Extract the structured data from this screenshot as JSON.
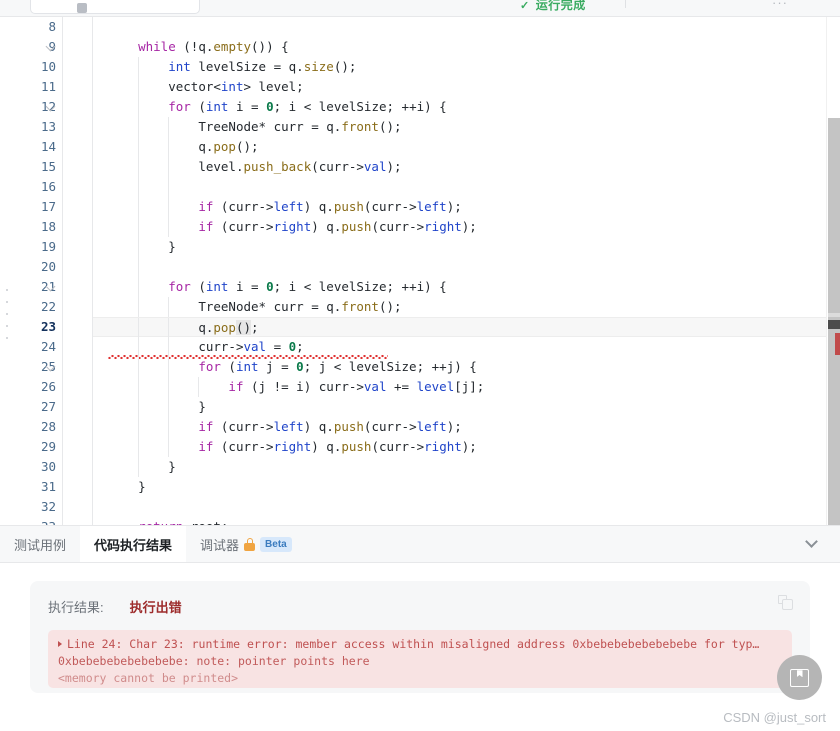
{
  "topbar": {
    "center_status": "运行完成",
    "check_glyph": "✓",
    "more_glyph": "···"
  },
  "editor": {
    "first_line_number": 8,
    "active_line_number": 23,
    "error_squiggle_line": 24,
    "lines": [
      {
        "n": 8,
        "indent": 0,
        "tokens": []
      },
      {
        "n": 9,
        "indent": 1,
        "fold": true,
        "tokens": [
          {
            "t": "while",
            "c": "kw"
          },
          {
            "t": " (!",
            "c": "pl"
          },
          {
            "t": "q",
            "c": "pl"
          },
          {
            "t": ".",
            "c": "pl"
          },
          {
            "t": "empty",
            "c": "fn"
          },
          {
            "t": "()) {",
            "c": "pl"
          }
        ]
      },
      {
        "n": 10,
        "indent": 2,
        "tokens": [
          {
            "t": "int",
            "c": "typ"
          },
          {
            "t": " levelSize = ",
            "c": "pl"
          },
          {
            "t": "q",
            "c": "pl"
          },
          {
            "t": ".",
            "c": "pl"
          },
          {
            "t": "size",
            "c": "fn"
          },
          {
            "t": "();",
            "c": "pl"
          }
        ]
      },
      {
        "n": 11,
        "indent": 2,
        "tokens": [
          {
            "t": "vector<",
            "c": "pl"
          },
          {
            "t": "int",
            "c": "typ"
          },
          {
            "t": "> level;",
            "c": "pl"
          }
        ]
      },
      {
        "n": 12,
        "indent": 2,
        "fold": true,
        "tokens": [
          {
            "t": "for",
            "c": "kw"
          },
          {
            "t": " (",
            "c": "pl"
          },
          {
            "t": "int",
            "c": "typ"
          },
          {
            "t": " i = ",
            "c": "pl"
          },
          {
            "t": "0",
            "c": "num"
          },
          {
            "t": "; i < levelSize; ++i) {",
            "c": "pl"
          }
        ]
      },
      {
        "n": 13,
        "indent": 3,
        "tokens": [
          {
            "t": "TreeNode* curr = ",
            "c": "pl"
          },
          {
            "t": "q",
            "c": "pl"
          },
          {
            "t": ".",
            "c": "pl"
          },
          {
            "t": "front",
            "c": "fn"
          },
          {
            "t": "();",
            "c": "pl"
          }
        ]
      },
      {
        "n": 14,
        "indent": 3,
        "tokens": [
          {
            "t": "q",
            "c": "pl"
          },
          {
            "t": ".",
            "c": "pl"
          },
          {
            "t": "pop",
            "c": "fn"
          },
          {
            "t": "();",
            "c": "pl"
          }
        ]
      },
      {
        "n": 15,
        "indent": 3,
        "tokens": [
          {
            "t": "level",
            "c": "pl"
          },
          {
            "t": ".",
            "c": "pl"
          },
          {
            "t": "push_back",
            "c": "fn"
          },
          {
            "t": "(curr->",
            "c": "pl"
          },
          {
            "t": "val",
            "c": "mem"
          },
          {
            "t": ");",
            "c": "pl"
          }
        ]
      },
      {
        "n": 16,
        "indent": 3,
        "tokens": []
      },
      {
        "n": 17,
        "indent": 3,
        "tokens": [
          {
            "t": "if",
            "c": "kw"
          },
          {
            "t": " (curr->",
            "c": "pl"
          },
          {
            "t": "left",
            "c": "mem"
          },
          {
            "t": ") q",
            "c": "pl"
          },
          {
            "t": ".",
            "c": "pl"
          },
          {
            "t": "push",
            "c": "fn"
          },
          {
            "t": "(curr->",
            "c": "pl"
          },
          {
            "t": "left",
            "c": "mem"
          },
          {
            "t": ");",
            "c": "pl"
          }
        ]
      },
      {
        "n": 18,
        "indent": 3,
        "tokens": [
          {
            "t": "if",
            "c": "kw"
          },
          {
            "t": " (curr->",
            "c": "pl"
          },
          {
            "t": "right",
            "c": "mem"
          },
          {
            "t": ") q",
            "c": "pl"
          },
          {
            "t": ".",
            "c": "pl"
          },
          {
            "t": "push",
            "c": "fn"
          },
          {
            "t": "(curr->",
            "c": "pl"
          },
          {
            "t": "right",
            "c": "mem"
          },
          {
            "t": ");",
            "c": "pl"
          }
        ]
      },
      {
        "n": 19,
        "indent": 2,
        "tokens": [
          {
            "t": "}",
            "c": "pl"
          }
        ]
      },
      {
        "n": 20,
        "indent": 2,
        "tokens": []
      },
      {
        "n": 21,
        "indent": 2,
        "fold": true,
        "tokens": [
          {
            "t": "for",
            "c": "kw"
          },
          {
            "t": " (",
            "c": "pl"
          },
          {
            "t": "int",
            "c": "typ"
          },
          {
            "t": " i = ",
            "c": "pl"
          },
          {
            "t": "0",
            "c": "num"
          },
          {
            "t": "; i < levelSize; ++i) {",
            "c": "pl"
          }
        ]
      },
      {
        "n": 22,
        "indent": 3,
        "tokens": [
          {
            "t": "TreeNode* curr = ",
            "c": "pl"
          },
          {
            "t": "q",
            "c": "pl"
          },
          {
            "t": ".",
            "c": "pl"
          },
          {
            "t": "front",
            "c": "fn"
          },
          {
            "t": "();",
            "c": "pl"
          }
        ]
      },
      {
        "n": 23,
        "indent": 3,
        "active": true,
        "tokens": [
          {
            "t": "q",
            "c": "pl"
          },
          {
            "t": ".",
            "c": "pl"
          },
          {
            "t": "pop",
            "c": "fn"
          },
          {
            "t": "(",
            "c": "brkt"
          },
          {
            "t": ")",
            "c": "brkt"
          },
          {
            "t": ";",
            "c": "pl"
          }
        ]
      },
      {
        "n": 24,
        "indent": 3,
        "squiggle": true,
        "tokens": [
          {
            "t": "curr->",
            "c": "pl"
          },
          {
            "t": "val",
            "c": "mem"
          },
          {
            "t": " = ",
            "c": "pl"
          },
          {
            "t": "0",
            "c": "num"
          },
          {
            "t": ";",
            "c": "pl"
          }
        ]
      },
      {
        "n": 25,
        "indent": 3,
        "fold": true,
        "tokens": [
          {
            "t": "for",
            "c": "kw"
          },
          {
            "t": " (",
            "c": "pl"
          },
          {
            "t": "int",
            "c": "typ"
          },
          {
            "t": " j = ",
            "c": "pl"
          },
          {
            "t": "0",
            "c": "num"
          },
          {
            "t": "; j < levelSize; ++j) {",
            "c": "pl"
          }
        ]
      },
      {
        "n": 26,
        "indent": 4,
        "tokens": [
          {
            "t": "if",
            "c": "kw"
          },
          {
            "t": " (j != i) curr->",
            "c": "pl"
          },
          {
            "t": "val",
            "c": "mem"
          },
          {
            "t": " += ",
            "c": "pl"
          },
          {
            "t": "level",
            "c": "mem"
          },
          {
            "t": "[j];",
            "c": "pl"
          }
        ]
      },
      {
        "n": 27,
        "indent": 3,
        "tokens": [
          {
            "t": "}",
            "c": "pl"
          }
        ]
      },
      {
        "n": 28,
        "indent": 3,
        "tokens": [
          {
            "t": "if",
            "c": "kw"
          },
          {
            "t": " (curr->",
            "c": "pl"
          },
          {
            "t": "left",
            "c": "mem"
          },
          {
            "t": ") q",
            "c": "pl"
          },
          {
            "t": ".",
            "c": "pl"
          },
          {
            "t": "push",
            "c": "fn"
          },
          {
            "t": "(curr->",
            "c": "pl"
          },
          {
            "t": "left",
            "c": "mem"
          },
          {
            "t": ");",
            "c": "pl"
          }
        ]
      },
      {
        "n": 29,
        "indent": 3,
        "tokens": [
          {
            "t": "if",
            "c": "kw"
          },
          {
            "t": " (curr->",
            "c": "pl"
          },
          {
            "t": "right",
            "c": "mem"
          },
          {
            "t": ") q",
            "c": "pl"
          },
          {
            "t": ".",
            "c": "pl"
          },
          {
            "t": "push",
            "c": "fn"
          },
          {
            "t": "(curr->",
            "c": "pl"
          },
          {
            "t": "right",
            "c": "mem"
          },
          {
            "t": ");",
            "c": "pl"
          }
        ]
      },
      {
        "n": 30,
        "indent": 2,
        "tokens": [
          {
            "t": "}",
            "c": "pl"
          }
        ]
      },
      {
        "n": 31,
        "indent": 1,
        "tokens": [
          {
            "t": "}",
            "c": "pl"
          }
        ]
      },
      {
        "n": 32,
        "indent": 1,
        "tokens": []
      },
      {
        "n": 33,
        "indent": 1,
        "tokens": [
          {
            "t": "return",
            "c": "kw"
          },
          {
            "t": " root;",
            "c": "pl"
          }
        ]
      }
    ]
  },
  "tabs": [
    {
      "label": "测试用例",
      "active": false,
      "lock": false,
      "badge": null
    },
    {
      "label": "代码执行结果",
      "active": true,
      "lock": false,
      "badge": null
    },
    {
      "label": "调试器",
      "active": false,
      "lock": true,
      "badge": "Beta"
    }
  ],
  "results": {
    "label": "执行结果:",
    "status": "执行出错",
    "status_color": "#9d2c2c",
    "error_lines": [
      "Line 24: Char 23: runtime error: member access within misaligned address 0xbebebebebebebebe for typ…",
      "0xbebebebebebebebe: note: pointer points here",
      "<memory cannot be printed>"
    ]
  },
  "watermark": "CSDN @just_sort"
}
